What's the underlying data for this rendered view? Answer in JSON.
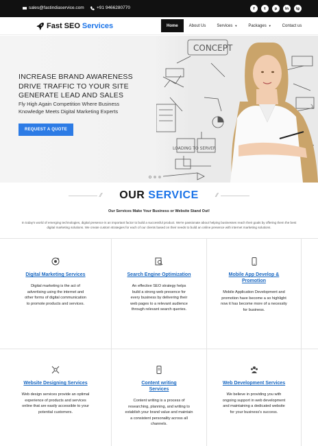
{
  "topbar": {
    "email": "sales@fastindiaservice.com",
    "phone": "+91 9466280770",
    "social": [
      "f",
      "t",
      "p",
      "in",
      "ig"
    ]
  },
  "brand": {
    "part1": "Fast SEO",
    "part2": "Services"
  },
  "nav": {
    "home": "Home",
    "about": "About Us",
    "services": "Services",
    "packages": "Packages",
    "contact": "Contact us"
  },
  "hero": {
    "headline": "INCREASE BRAND AWARENESS DRIVE TRAFFIC TO YOUR SITE GENERATE LEAD AND SALES",
    "subline": "Fly High Again Competition Where Business Knowledge Meets Digital Marketing Experts",
    "cta": "REQUEST A QUOTE"
  },
  "service_section": {
    "title_1": "OUR",
    "title_2": "SERVICE",
    "tagline": "Our Services Make Your Business or Website Stand Out!",
    "intro": "In today's world of emerging technologies, digital presence is an important factor to build a successful product. We're passionate about helping businesses reach their goals by offering them the best digital marketing solutions. We create custom strategies for each of our clients based on their needs to build an online presence with internet marketing solutions."
  },
  "cards": [
    {
      "icon": "digital-marketing-icon",
      "title": "Digital Marketing Services",
      "text": "Digital marketing is the act of advertising using the internet and other forms of digital communication to promote products and services."
    },
    {
      "icon": "seo-icon",
      "title": "Search Engine Optimization",
      "text": "An effective SEO strategy helps build a strong web presence for every business by delivering their web pages to a relevant audience through relevant search queries."
    },
    {
      "icon": "mobile-app-icon",
      "title": "Mobile App Develop & Promotion",
      "text": "Mobile Application Development and promotion have become a so highlight now it has become more of a necessity for business."
    },
    {
      "icon": "website-design-icon",
      "title": "Website Designing Services",
      "text": "Web design services provide an optimal experience of products and services online that are easily accessible to your potential customers."
    },
    {
      "icon": "content-writing-icon",
      "title": "Content writing Services",
      "text": "Content writing is a process of researching, planning, and writing to establish your brand value and maintain a consistent personality across all channels."
    },
    {
      "icon": "web-development-icon",
      "title": "Web Development Services",
      "text": "We believe in providing you with ongoing support in web development and maintaining a dedicated website for your business's success."
    }
  ]
}
